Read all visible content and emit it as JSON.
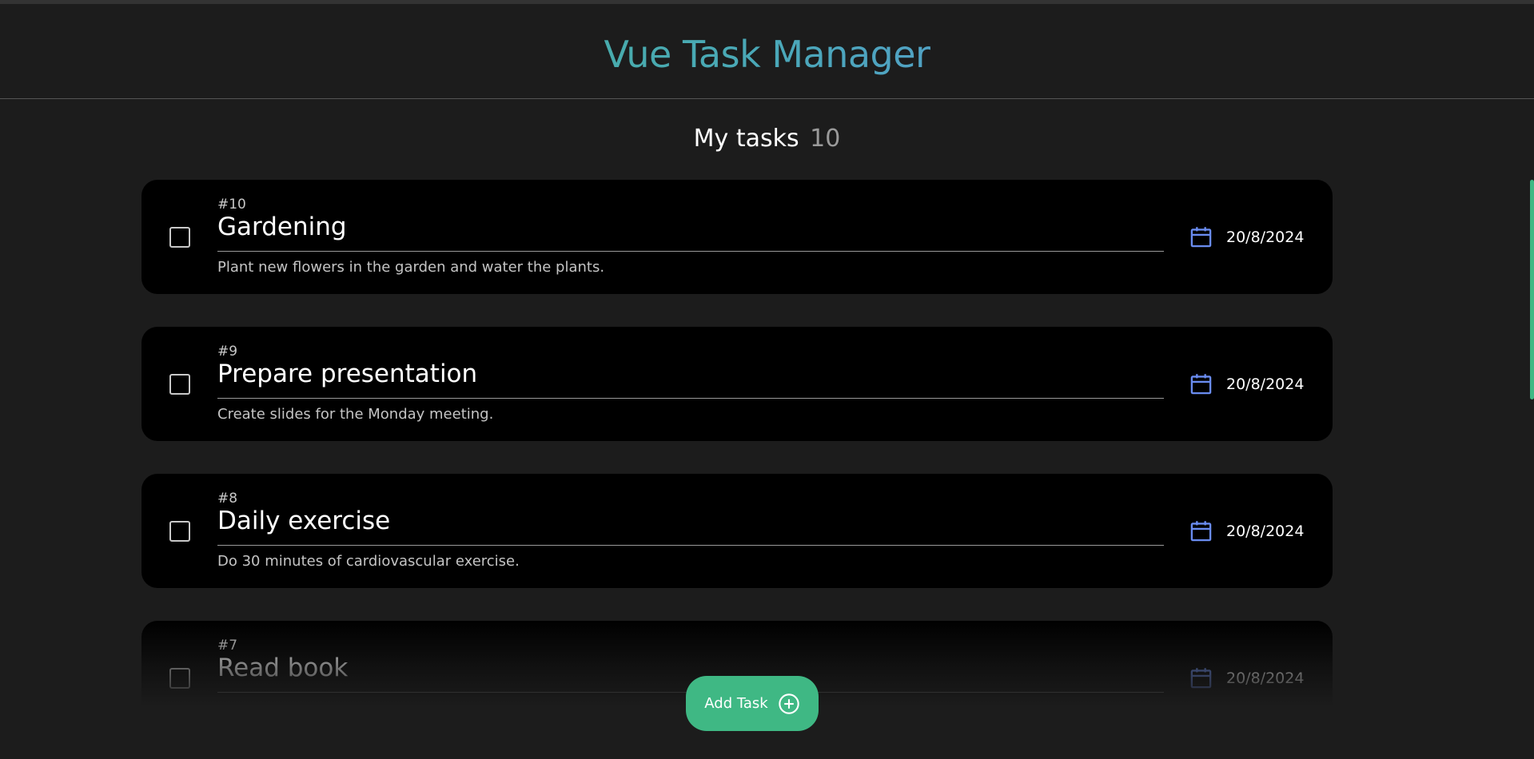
{
  "header": {
    "app_title": "Vue Task Manager"
  },
  "tasks_heading": {
    "label": "My tasks",
    "count": "10"
  },
  "tasks": [
    {
      "id": "#10",
      "title": "Gardening",
      "description": "Plant new flowers in the garden and water the plants.",
      "date": "20/8/2024",
      "completed": false
    },
    {
      "id": "#9",
      "title": "Prepare presentation",
      "description": "Create slides for the Monday meeting.",
      "date": "20/8/2024",
      "completed": false
    },
    {
      "id": "#8",
      "title": "Daily exercise",
      "description": "Do 30 minutes of cardiovascular exercise.",
      "date": "20/8/2024",
      "completed": false
    },
    {
      "id": "#7",
      "title": "Read book",
      "description": "",
      "date": "20/8/2024",
      "completed": false
    }
  ],
  "add_button": {
    "label": "Add Task",
    "icon": "plus-circle-icon"
  },
  "icons": {
    "date": "calendar-icon",
    "checkbox": "checkbox-unchecked"
  },
  "colors": {
    "background": "#1c1c1c",
    "card": "#000000",
    "accent_green": "#42b883",
    "accent_blue": "#6a8cf0",
    "button": "#3fb884"
  }
}
